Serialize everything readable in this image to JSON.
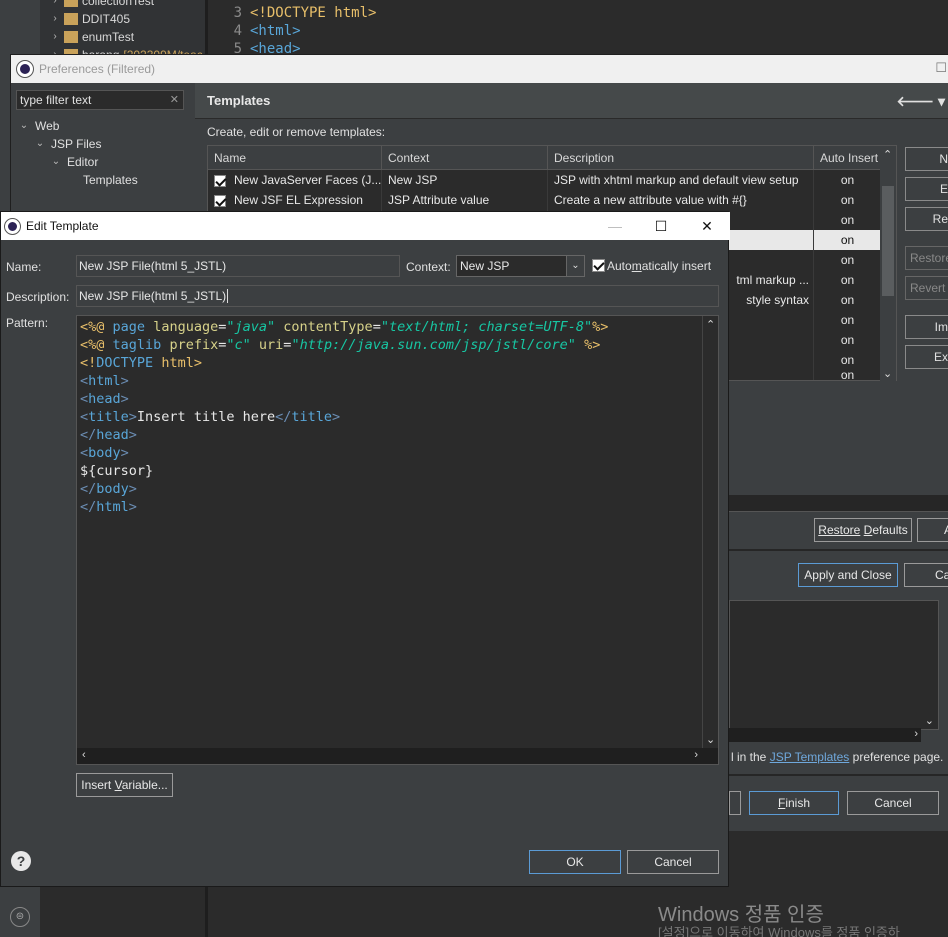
{
  "background": {
    "tree_items": [
      "collectionTest",
      "DDIT405",
      "enumTest",
      "harang"
    ],
    "tree_extra": "[202309M/teac",
    "code_lines": [
      {
        "num": "3",
        "text": "<!DOCTYPE html>"
      },
      {
        "num": "4",
        "text": "<html>"
      },
      {
        "num": "5",
        "text": "<head>"
      }
    ],
    "windows_activation_1": "Windows 정품 인증",
    "windows_activation_2": "[설정]으로 이동하여 Windows를 정품 인증하"
  },
  "preferences": {
    "title": "Preferences (Filtered)",
    "filter_text": "type filter text",
    "tree": [
      {
        "label": "Web",
        "level": 0
      },
      {
        "label": "JSP Files",
        "level": 1
      },
      {
        "label": "Editor",
        "level": 2
      },
      {
        "label": "Templates",
        "level": 3
      }
    ],
    "header": "Templates",
    "subtitle": "Create, edit or remove templates:",
    "columns": [
      "Name",
      "Context",
      "Description",
      "Auto Insert"
    ],
    "rows": [
      {
        "name": "New JavaServer Faces (J...",
        "context": "New JSP",
        "description": "JSP with xhtml markup and default view setup",
        "auto": "on"
      },
      {
        "name": "New JSF EL Expression",
        "context": "JSP Attribute value",
        "description": "Create a new attribute value with #{}",
        "auto": "on"
      },
      {
        "name": "",
        "context": "",
        "description": "",
        "auto": "on"
      },
      {
        "name": "",
        "context": "",
        "description": "",
        "auto": "on"
      },
      {
        "name": "",
        "context": "",
        "description": "",
        "auto": "on"
      },
      {
        "name": "",
        "context": "",
        "description": "tml markup ...",
        "auto": "on"
      },
      {
        "name": "",
        "context": "",
        "description": "style syntax",
        "auto": "on"
      },
      {
        "name": "",
        "context": "",
        "description": "",
        "auto": "on"
      },
      {
        "name": "",
        "context": "",
        "description": "",
        "auto": "on"
      },
      {
        "name": "",
        "context": "",
        "description": "",
        "auto": "on"
      },
      {
        "name": "",
        "context": "",
        "description": "",
        "auto": "on"
      }
    ],
    "side_buttons": [
      "N",
      "E",
      "Re",
      "Restore",
      "Revert",
      "Im",
      "Ex"
    ],
    "restore_defaults": "Restore Defaults",
    "apply_label": "A",
    "apply_and_close": "Apply and Close",
    "cancel_partial": "Ca",
    "link_prefix": "l in the ",
    "link_text": "JSP Templates",
    "link_suffix": " preference page.",
    "finish": "Finish",
    "cancel": "Cancel"
  },
  "edit_template": {
    "title": "Edit Template",
    "name_label": "Name:",
    "name_value": "New JSP File(html 5_JSTL)",
    "context_label": "Context:",
    "context_value": "New JSP",
    "auto_insert_label": "Automatically insert",
    "description_label": "Description:",
    "description_value": "New JSP File(html 5_JSTL)",
    "pattern_label": "Pattern:",
    "insert_variable": "Insert Variable...",
    "ok": "OK",
    "cancel": "Cancel"
  }
}
